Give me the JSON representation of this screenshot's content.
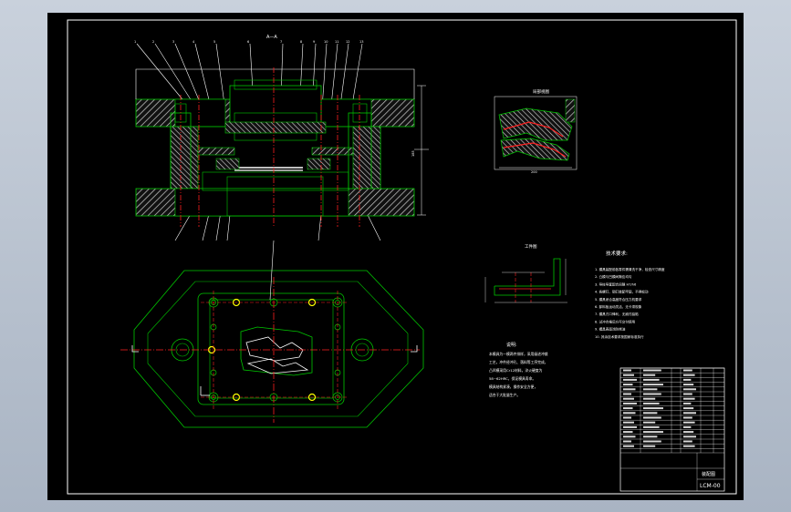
{
  "drawing": {
    "section_label": "A—A",
    "detail_view_label": "局部视图",
    "part_view_label": "工件图",
    "tech_req_title": "技术要求:",
    "tech_req_items": [
      "1. 模具装配前各零件需清洗干净，检查尺寸精度",
      "2. 凸模与凹模间隙应均匀",
      "3. 导柱导套配合间隙 H7/h6",
      "4. 各螺钉、销钉装配牢固，不得松动",
      "5. 模具闭合高度符合压力机要求",
      "6. 卸料板运动灵活，无卡滞现象",
      "7. 模具刃口锋利，无崩刃缺陷",
      "8. 试冲合格后方可交付使用",
      "9. 模具表面涂防锈油",
      "10. 其余技术要求按国家标准执行"
    ],
    "notes_title": "说明:",
    "notes_lines": [
      "本模具为一模两件排样，采用级进冲裁",
      "工艺，冲件经冲孔、落料等工序完成，",
      "凸凹模采用Cr12材料，淬火硬度为",
      "58~62HRC，保证模具寿命。",
      "模具结构紧凑，操作安全方便，",
      "适合于大批量生产。"
    ],
    "title_block": {
      "drawing_name": "装配图",
      "drawing_code": "LCM-00"
    }
  },
  "colors": {
    "background": "#000000",
    "outline": "#00c800",
    "centerline": "#ff2020",
    "hatch": "#ffffff",
    "dimension": "#ffffff",
    "hole": "#ffff00",
    "viewport_frame": "#b4bccb"
  }
}
